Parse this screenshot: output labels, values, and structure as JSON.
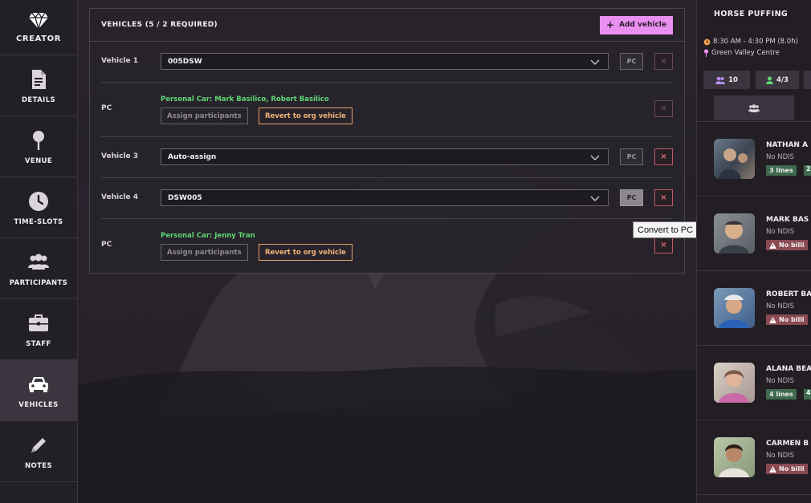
{
  "nav": {
    "brand_label": "CREATOR",
    "items": [
      {
        "label": "DETAILS",
        "icon": "document-icon"
      },
      {
        "label": "VENUE",
        "icon": "map-pin-icon"
      },
      {
        "label": "TIME-SLOTS",
        "icon": "clock-icon"
      },
      {
        "label": "PARTICIPANTS",
        "icon": "users-icon"
      },
      {
        "label": "STAFF",
        "icon": "briefcase-icon"
      },
      {
        "label": "VEHICLES",
        "icon": "car-icon"
      },
      {
        "label": "NOTES",
        "icon": "pencil-icon"
      }
    ],
    "active": "VEHICLES"
  },
  "vehicles": {
    "title": "VEHICLES (5 / 2 REQUIRED)",
    "add_label": "Add vehicle",
    "pc_label": "PC",
    "remove_label": "×",
    "assign_label": "Assign participants",
    "revert_label": "Revert to org vehicle",
    "rows": [
      {
        "label": "Vehicle 1",
        "value": "005DSW"
      },
      {
        "label": "PC",
        "pc_name": "Personal Car: Mark Basilico, Robert Basilico"
      },
      {
        "label": "Vehicle 3",
        "value": "Auto-assign"
      },
      {
        "label": "Vehicle 4",
        "value": "DSW005"
      },
      {
        "label": "PC",
        "pc_name": "Personal Car: Jenny Tran"
      }
    ],
    "tooltip": "Convert to PC"
  },
  "activity": {
    "title": "HORSE PUFFING",
    "time": "8:30 AM - 4:30 PM (8.0h)",
    "location": "Green Valley Centre",
    "stat_participants": "10",
    "stat_staff": "4/3",
    "participants": [
      {
        "name": "NATHAN A",
        "sub": "No NDIS",
        "badge": "3 lines",
        "badge_type": "green",
        "extra": "2"
      },
      {
        "name": "MARK BAS",
        "sub": "No NDIS",
        "badge": "No billi",
        "badge_type": "red"
      },
      {
        "name": "ROBERT BA",
        "sub": "No NDIS",
        "badge": "No billi",
        "badge_type": "red"
      },
      {
        "name": "ALANA BEA",
        "sub": "No NDIS",
        "badge": "4 lines",
        "badge_type": "green",
        "extra": "4"
      },
      {
        "name": "CARMEN B",
        "sub": "No NDIS",
        "badge": "No billi",
        "badge_type": "red"
      }
    ]
  },
  "colors": {
    "accent": "#e98ff0",
    "pc_green": "#5fd673",
    "revert_orange": "#f1b27a",
    "remove_red": "#e0707a"
  }
}
